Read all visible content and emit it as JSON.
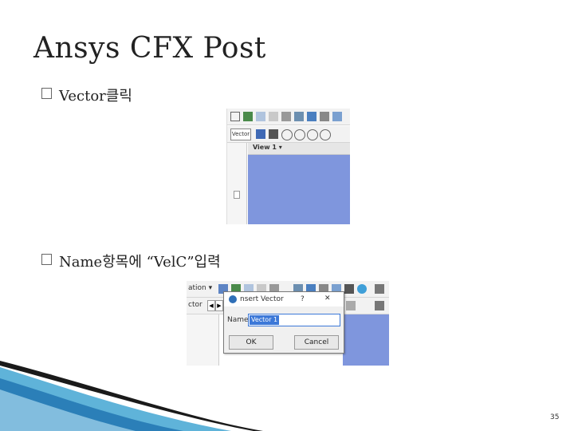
{
  "slide": {
    "title": "Ansys CFX Post",
    "bullets": [
      {
        "text": "Vector클릭"
      },
      {
        "text": "Name항목에 “VelC”입력"
      }
    ],
    "page_number": "35"
  },
  "screenshot1": {
    "tooltip": "Vector",
    "view_tab": "View 1 ▾"
  },
  "screenshot2": {
    "left_label_top": "ation ▾",
    "left_label_bottom": "ctor",
    "dialog": {
      "title": "nsert Vector",
      "help": "?",
      "close": "✕",
      "name_label": "Name",
      "name_value": "Vector 1",
      "ok": "OK",
      "cancel": "Cancel"
    }
  },
  "colors": {
    "viewport": "#7f96dd",
    "selection": "#3c78d8"
  }
}
